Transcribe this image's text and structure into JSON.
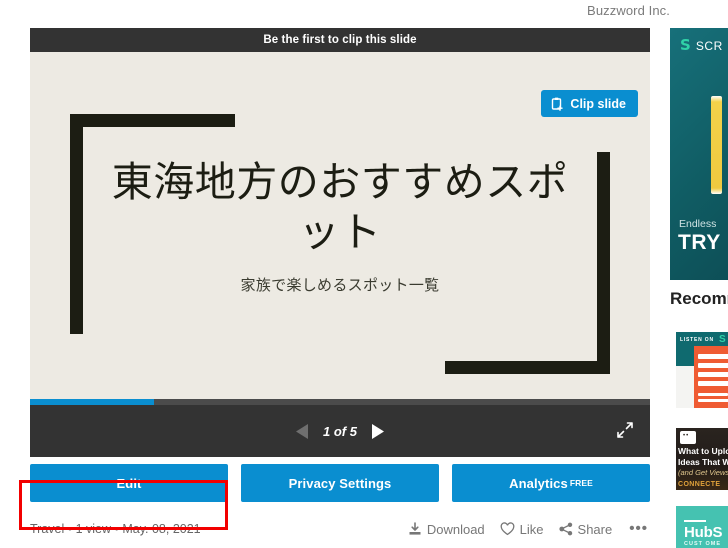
{
  "brand": {
    "name": "Buzzword Inc."
  },
  "player": {
    "clip_banner_text": "Be the first to clip this slide",
    "clip_slide_button": "Clip slide",
    "clip_icon": "clipboard-plus-icon",
    "slide": {
      "title": "東海地方のおすすめスポット",
      "subtitle": "家族で楽しめるスポット一覧",
      "background_color": "#edeae3",
      "frame_color": "#1c1d13"
    },
    "progress": {
      "percent": 20,
      "fill_color": "#0a8ed0",
      "track_color": "#4b4b4b"
    },
    "controls": {
      "prev_icon": "previous-slide-arrow-icon",
      "next_icon": "next-slide-arrow-icon",
      "counter": "1 of 5",
      "current_slide": 1,
      "total_slides": 5,
      "fullscreen_icon": "fullscreen-expand-icon"
    }
  },
  "actions": {
    "accent_color": "#0a8ed0",
    "buttons": [
      {
        "label": "Edit",
        "superscript": ""
      },
      {
        "label": "Privacy Settings",
        "superscript": ""
      },
      {
        "label": "Analytics",
        "superscript": "FREE"
      }
    ]
  },
  "highlight": {
    "target": "Edit",
    "color": "#f20000"
  },
  "meta": {
    "category": "Travel",
    "views": "1 view",
    "date": "May. 08, 2021",
    "summary": "Travel • 1 view • May. 08, 2021",
    "actions": [
      {
        "label": "Download",
        "icon": "download-icon"
      },
      {
        "label": "Like",
        "icon": "heart-icon"
      },
      {
        "label": "Share",
        "icon": "share-icon"
      }
    ],
    "more_label": "•••",
    "more_icon": "more-options-icon"
  },
  "sidebar": {
    "ad": {
      "logo_mark": "S",
      "logo_text": "SCR",
      "subtitle": "Endless",
      "cta": "TRY",
      "background_color": "#105c63"
    },
    "recommended_heading": "Recommended",
    "thumbnails": [
      {
        "id": "negotiation-book",
        "listen_label": "LISTEN ON",
        "logo": "S",
        "lines": [
          "THE ONL",
          "NEGOTIA",
          "GUIDE Y",
          "EVER NE"
        ]
      },
      {
        "id": "what-to-upload",
        "line1": "What to Uploa",
        "line2": "Ideas That Will",
        "line3": "(and Get Views)",
        "bottom": "CONNECTE"
      },
      {
        "id": "hubspot",
        "name": "HubS",
        "sub": "CUST OME"
      }
    ]
  }
}
